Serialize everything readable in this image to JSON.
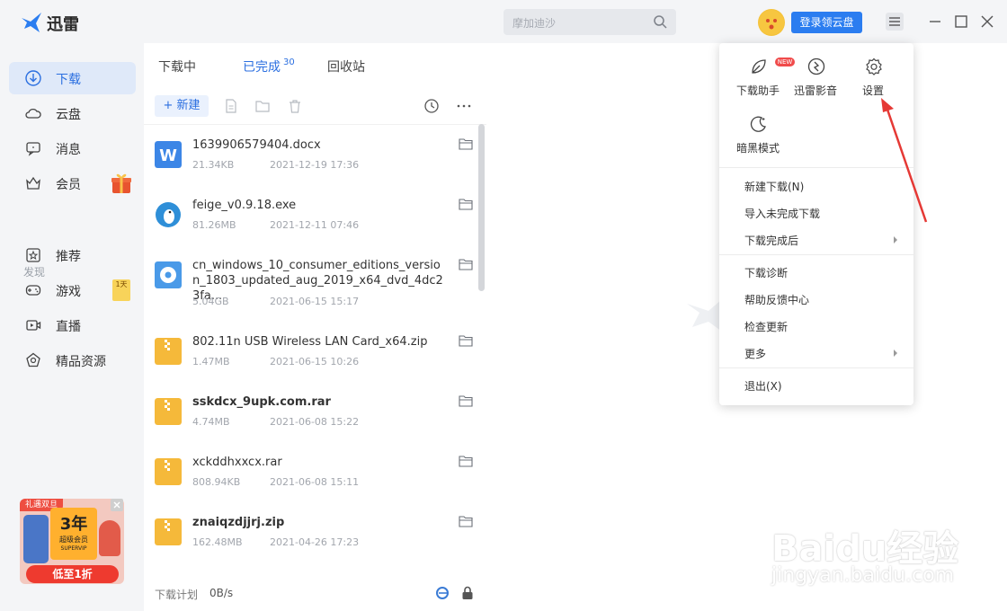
{
  "app": {
    "title": "迅雷"
  },
  "header": {
    "search_placeholder": "摩加迪沙",
    "login_button": "登录领云盘"
  },
  "sidebar": {
    "items": [
      {
        "label": "下载",
        "icon": "download-icon",
        "active": true
      },
      {
        "label": "云盘",
        "icon": "cloud-icon"
      },
      {
        "label": "消息",
        "icon": "message-icon"
      },
      {
        "label": "会员",
        "icon": "vip-crown-icon"
      }
    ],
    "section": "发现",
    "discover": [
      {
        "label": "推荐",
        "icon": "star-icon"
      },
      {
        "label": "游戏",
        "icon": "gamepad-icon"
      },
      {
        "label": "直播",
        "icon": "live-icon"
      },
      {
        "label": "精品资源",
        "icon": "diamond-icon"
      }
    ],
    "game_badge": "1天",
    "promo": {
      "tag": "礼遇双旦",
      "years": "3年",
      "subtitle": "超级会员",
      "brand": "SUPERVIP",
      "button": "低至1折"
    }
  },
  "downloads": {
    "tabs": [
      {
        "label": "下载中"
      },
      {
        "label": "已完成",
        "count": "30",
        "active": true
      },
      {
        "label": "回收站"
      }
    ],
    "new_button": "+ 新建",
    "files": [
      {
        "name": "1639906579404.docx",
        "size": "21.34KB",
        "date": "2021-12-19 17:36",
        "icon": "word-doc-icon",
        "bold": false
      },
      {
        "name": "feige_v0.9.18.exe",
        "size": "81.26MB",
        "date": "2021-12-11 07:46",
        "icon": "penguin-exe-icon",
        "bold": false
      },
      {
        "name": "cn_windows_10_consumer_editions_version_1803_updated_aug_2019_x64_dvd_4dc23fa...",
        "size": "5.04GB",
        "date": "2021-06-15 15:17",
        "icon": "disc-iso-icon",
        "bold": false
      },
      {
        "name": "802.11n USB Wireless LAN Card_x64.zip",
        "size": "1.47MB",
        "date": "2021-06-15 10:26",
        "icon": "zip-icon",
        "bold": false
      },
      {
        "name": "sskdcx_9upk.com.rar",
        "size": "4.74MB",
        "date": "2021-06-08 15:22",
        "icon": "zip-icon",
        "bold": true
      },
      {
        "name": "xckddhxxcx.rar",
        "size": "808.94KB",
        "date": "2021-06-08 15:11",
        "icon": "zip-icon",
        "bold": false
      },
      {
        "name": "znaiqzdjjrj.zip",
        "size": "162.48MB",
        "date": "2021-04-26 17:23",
        "icon": "zip-icon",
        "bold": true
      }
    ],
    "status": {
      "plan": "下载计划",
      "speed": "0B/s"
    }
  },
  "menu": {
    "grid": [
      {
        "label": "下载助手",
        "icon": "leaf-icon",
        "badge": "NEW"
      },
      {
        "label": "迅雷影音",
        "icon": "media-player-icon"
      },
      {
        "label": "设置",
        "icon": "gear-icon"
      },
      {
        "label": "暗黑模式",
        "icon": "moon-icon"
      }
    ],
    "items": [
      {
        "label": "新建下载(N)"
      },
      {
        "label": "导入未完成下载"
      },
      {
        "label": "下载完成后",
        "submenu": true
      },
      {
        "label": "下载诊断"
      },
      {
        "label": "帮助反馈中心"
      },
      {
        "label": "检查更新"
      },
      {
        "label": "更多",
        "submenu": true
      },
      {
        "label": "退出(X)"
      }
    ]
  },
  "watermark": {
    "text": "Baidu经验",
    "url": "jingyan.baidu.com"
  },
  "colors": {
    "accent": "#2b6fe0",
    "button": "#2b7df0",
    "annotation_arrow": "#e53935"
  }
}
